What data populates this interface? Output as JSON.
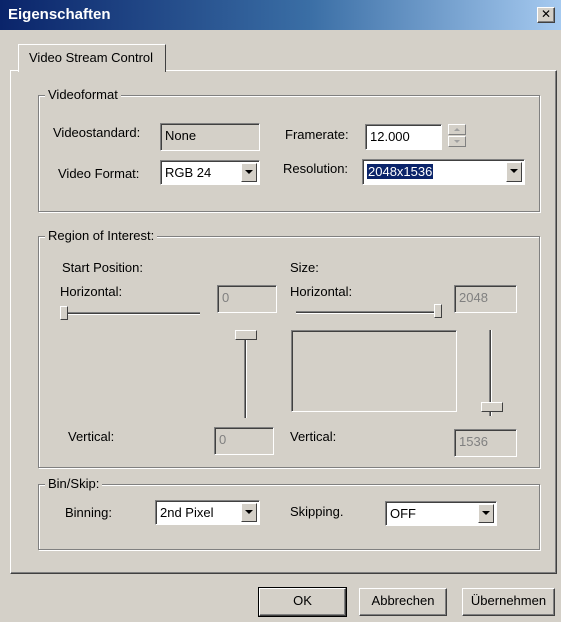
{
  "window": {
    "title": "Eigenschaften",
    "close_glyph": "✕"
  },
  "tab": {
    "label": "Video Stream Control"
  },
  "videoformat": {
    "legend": "Videoformat",
    "videostandard_label": "Videostandard:",
    "videostandard_value": "None",
    "videoformat_label": "Video Format:",
    "videoformat_value": "RGB 24",
    "framerate_label": "Framerate:",
    "framerate_value": "12.000",
    "resolution_label": "Resolution:",
    "resolution_value": "2048x1536"
  },
  "roi": {
    "legend": "Region of Interest:",
    "start_position_label": "Start Position:",
    "start_horizontal_label": "Horizontal:",
    "start_horizontal_value": "0",
    "start_vertical_label": "Vertical:",
    "start_vertical_value": "0",
    "size_label": "Size:",
    "size_horizontal_label": "Horizontal:",
    "size_horizontal_value": "2048",
    "size_vertical_label": "Vertical:",
    "size_vertical_value": "1536"
  },
  "binskip": {
    "legend": "Bin/Skip:",
    "binning_label": "Binning:",
    "binning_value": "2nd Pixel",
    "skipping_label": "Skipping.",
    "skipping_value": "OFF"
  },
  "buttons": {
    "ok": "OK",
    "cancel": "Abbrechen",
    "apply": "Übernehmen"
  }
}
